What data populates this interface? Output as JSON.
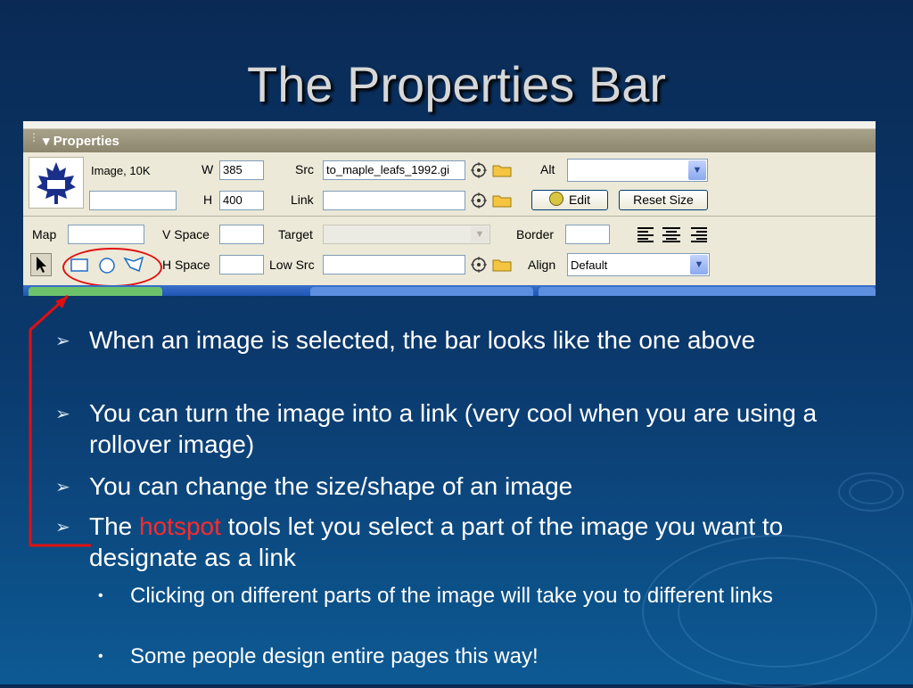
{
  "slide": {
    "title": "The Properties Bar"
  },
  "panel": {
    "header": "Properties",
    "image_size": "Image, 10K",
    "name_value": "",
    "w_label": "W",
    "w_value": "385",
    "h_label": "H",
    "h_value": "400",
    "src_label": "Src",
    "src_value": "to_maple_leafs_1992.gi",
    "link_label": "Link",
    "link_value": "",
    "alt_label": "Alt",
    "alt_value": "",
    "edit_label": "Edit",
    "reset_label": "Reset Size",
    "map_label": "Map",
    "map_value": "",
    "vspace_label": "V Space",
    "vspace_value": "",
    "target_label": "Target",
    "target_value": "",
    "border_label": "Border",
    "border_value": "",
    "hspace_label": "H Space",
    "hspace_value": "",
    "lowsrc_label": "Low Src",
    "lowsrc_value": "",
    "align_label": "Align",
    "align_value": "Default",
    "colors": {
      "panel_bg": "#ece9d8",
      "header_bg": "#9c957d",
      "highlight_circle": "#e01010",
      "field_border": "#7f9db9"
    }
  },
  "bullets": [
    {
      "level": 1,
      "text": "When an image is selected, the bar looks like the one above"
    },
    {
      "level": 1,
      "text": "You can turn the image into a link (very cool when you are using a rollover image)"
    },
    {
      "level": 1,
      "text": "You can change the size/shape of an image"
    },
    {
      "level": 1,
      "before": "The ",
      "highlight": "hotspot",
      "after": " tools let you select a part of the image you want to designate as a link"
    },
    {
      "level": 2,
      "text": "Clicking on different parts of the image will take you to different links"
    },
    {
      "level": 2,
      "text": "Some people design entire pages this way!"
    }
  ],
  "icons": {
    "level1_marker": "➢",
    "level2_marker": "•"
  }
}
